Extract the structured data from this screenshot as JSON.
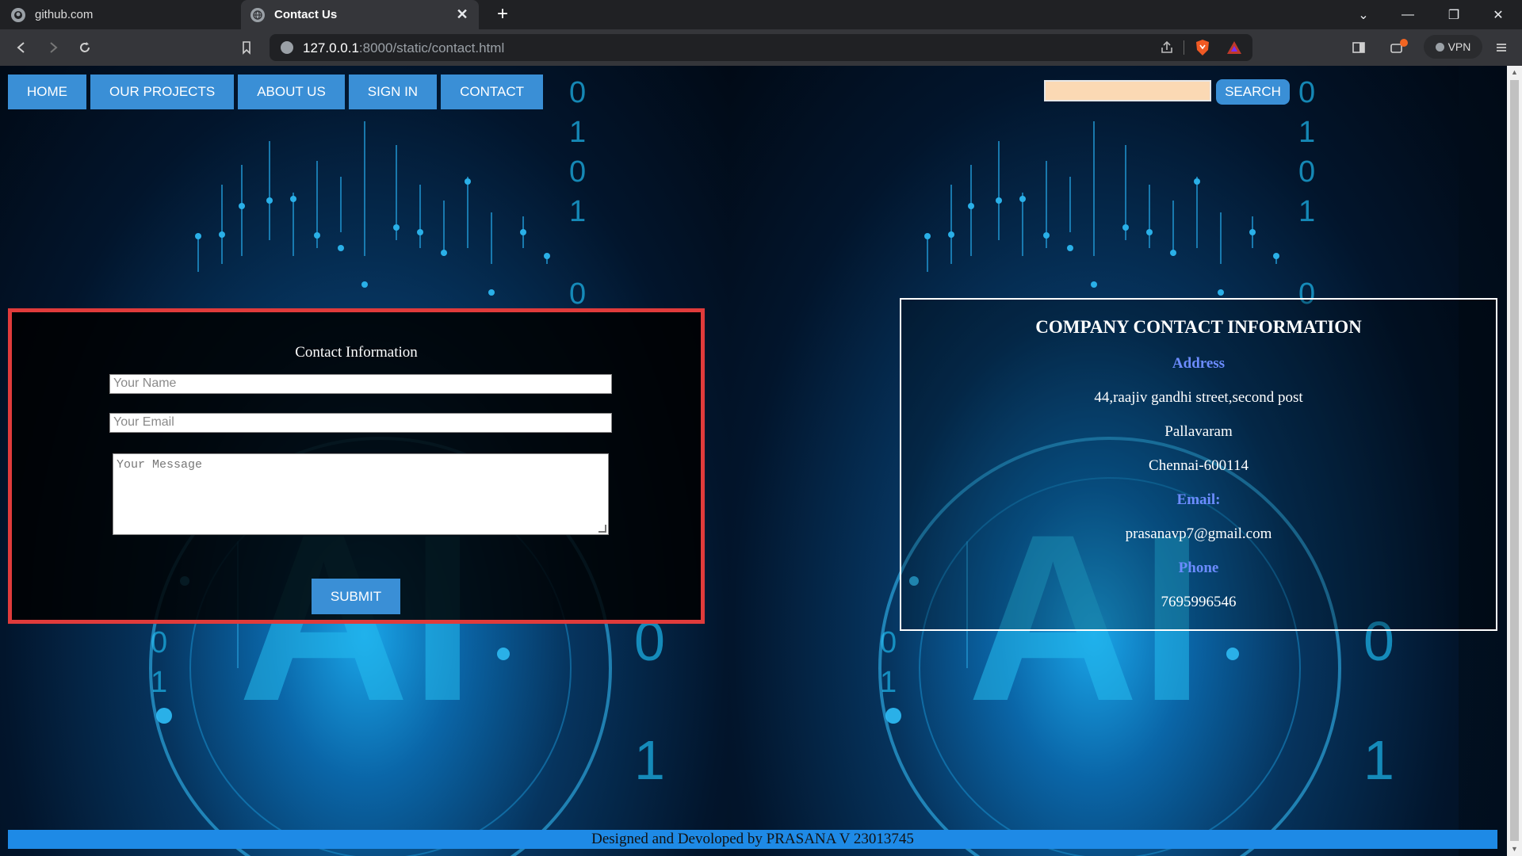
{
  "browser": {
    "tabs": [
      {
        "title": "github.com"
      },
      {
        "title": "Contact Us"
      }
    ],
    "url_host": "127.0.0.1",
    "url_path": ":8000/static/contact.html",
    "vpn_label": "VPN"
  },
  "nav": {
    "items": [
      "HOME",
      "OUR PROJECTS",
      "ABOUT US",
      "SIGN IN",
      "CONTACT"
    ]
  },
  "search": {
    "value": "",
    "button_label": "SEARCH"
  },
  "contact_form": {
    "title": "Contact Information",
    "name_placeholder": "Your Name",
    "email_placeholder": "Your Email",
    "message_placeholder": "Your Message",
    "submit_label": "SUBMIT"
  },
  "company_info": {
    "heading": "COMPANY CONTACT INFORMATION",
    "address_label": "Address",
    "address_line1": "44,raajiv gandhi street,second post",
    "address_line2": "Pallavaram",
    "address_line3": "Chennai-600114",
    "email_label": "Email:",
    "email": "prasanavp7@gmail.com",
    "phone_label": "Phone",
    "phone": "7695996546"
  },
  "footer": {
    "text": "Designed and Devoloped by PRASANA V 23013745"
  },
  "background": {
    "big_letters": "AI",
    "digits": [
      "0",
      "1"
    ]
  },
  "colors": {
    "nav_button": "#3a8fd6",
    "form_border": "#e03b3b",
    "label_blue": "#6c8cff",
    "footer": "#1e8ae6",
    "search_field": "#fbd9b4"
  }
}
